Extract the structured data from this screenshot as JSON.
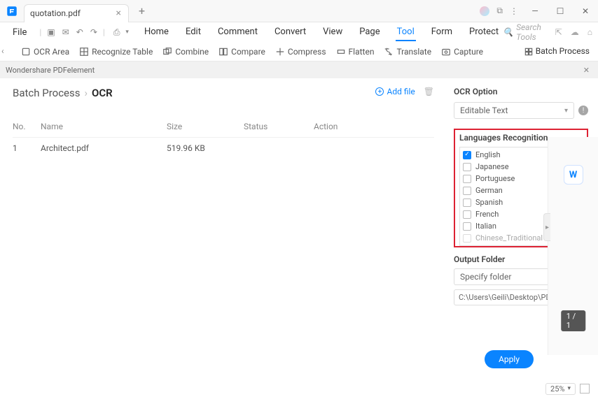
{
  "tab": {
    "title": "quotation.pdf"
  },
  "file_menu": "File",
  "main_tabs": {
    "home": "Home",
    "edit": "Edit",
    "comment": "Comment",
    "convert": "Convert",
    "view": "View",
    "page": "Page",
    "tool": "Tool",
    "form": "Form",
    "protect": "Protect"
  },
  "search_tools": "Search Tools",
  "subtools": {
    "ocr_area": "OCR Area",
    "recognize_table": "Recognize Table",
    "combine": "Combine",
    "compare": "Compare",
    "compress": "Compress",
    "flatten": "Flatten",
    "translate": "Translate",
    "capture": "Capture",
    "batch_process": "Batch Process"
  },
  "panel_header": "Wondershare PDFelement",
  "breadcrumb": {
    "parent": "Batch Process",
    "current": "OCR"
  },
  "add_file": "Add file",
  "table": {
    "headers": {
      "no": "No.",
      "name": "Name",
      "size": "Size",
      "status": "Status",
      "action": "Action"
    },
    "rows": [
      {
        "no": "1",
        "name": "Architect.pdf",
        "size": "519.96 KB",
        "status": "",
        "action": ""
      }
    ]
  },
  "ocr_option": {
    "title": "OCR Option",
    "mode": "Editable Text"
  },
  "languages": {
    "title": "Languages Recognition",
    "items": [
      {
        "label": "English",
        "checked": true
      },
      {
        "label": "Japanese",
        "checked": false
      },
      {
        "label": "Portuguese",
        "checked": false
      },
      {
        "label": "German",
        "checked": false
      },
      {
        "label": "Spanish",
        "checked": false
      },
      {
        "label": "French",
        "checked": false
      },
      {
        "label": "Italian",
        "checked": false
      },
      {
        "label": "Chinese_Traditional",
        "checked": false
      }
    ]
  },
  "output_folder": {
    "title": "Output Folder",
    "mode": "Specify folder",
    "path": "C:\\Users\\Geili\\Desktop\\PDFelement\\OC"
  },
  "apply": "Apply",
  "page_count": "1 / 1",
  "zoom": "25%"
}
